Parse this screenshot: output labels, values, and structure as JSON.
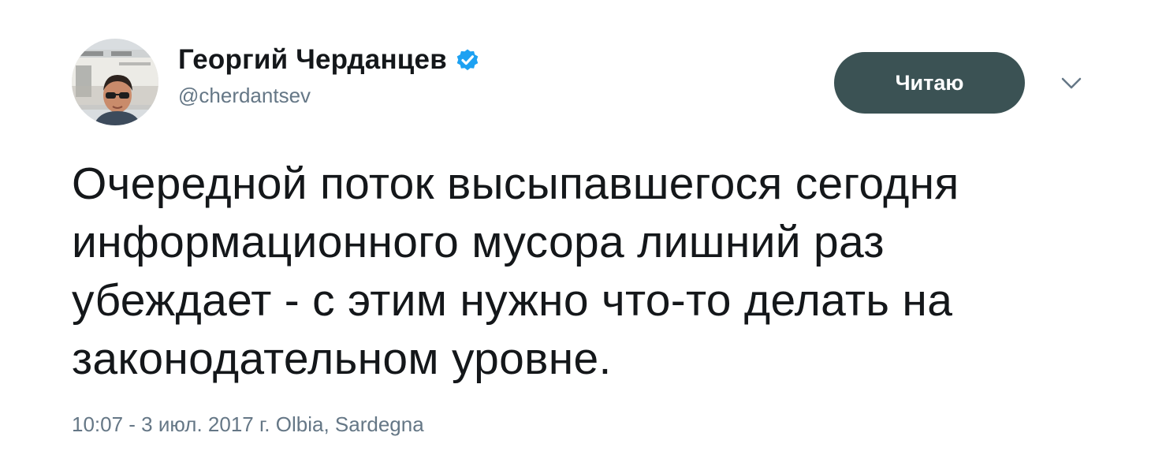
{
  "tweet": {
    "author": {
      "display_name": "Георгий Черданцев",
      "screen_name": "@cherdantsev",
      "verified": true,
      "avatar_icon": "user-avatar-photo"
    },
    "follow_button_label": "Читаю",
    "menu_icon": "chevron-down-icon",
    "text_lines": [
      "Очередной поток высыпавшегося сегодня",
      "информационного мусора лишний раз",
      "убеждает - с этим нужно что-то делать на",
      "законодательном уровне."
    ],
    "timestamp": "10:07 - 3 июл. 2017 г.",
    "location": "Olbia, Sardegna"
  },
  "colors": {
    "text_primary": "#14171a",
    "text_secondary": "#657786",
    "button_bg": "#3b5254",
    "verified_blue": "#1da1f2"
  }
}
